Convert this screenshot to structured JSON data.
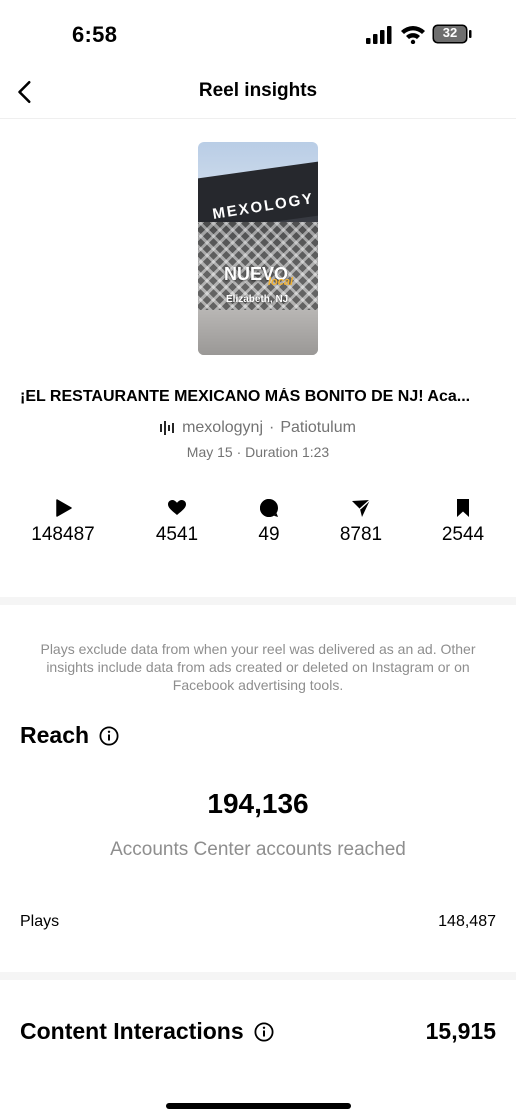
{
  "status_bar": {
    "time": "6:58",
    "battery": "32"
  },
  "nav": {
    "title": "Reel insights"
  },
  "reel": {
    "thumbnail": {
      "sign_text": "MEXOLOGY",
      "overlay_main": "NUEVO",
      "overlay_accent": "local",
      "overlay_city": "Elizabeth, NJ"
    },
    "caption": "¡EL RESTAURANTE MEXICANO MÁS BONITO DE NJ! Aca...",
    "author": "mexologynj",
    "separator": "·",
    "audio": "Patiotulum",
    "date_line": "May 15 · Duration 1:23"
  },
  "stats": {
    "plays": "148487",
    "likes": "4541",
    "comments": "49",
    "shares": "8781",
    "saves": "2544"
  },
  "disclaimer": "Plays exclude data from when your reel was delivered as an ad. Other insights include data from ads created or deleted on Instagram or on Facebook advertising tools.",
  "reach": {
    "title": "Reach",
    "value": "194,136",
    "label": "Accounts Center accounts reached",
    "plays_label": "Plays",
    "plays_value": "148,487"
  },
  "content_interactions": {
    "title": "Content Interactions",
    "value": "15,915"
  },
  "icons": {
    "back": "chevron-left-icon",
    "audio": "audio-wave-icon",
    "play": "play-icon",
    "like": "heart-icon",
    "comment": "comment-icon",
    "share": "send-icon",
    "save": "bookmark-icon",
    "info": "info-icon"
  }
}
